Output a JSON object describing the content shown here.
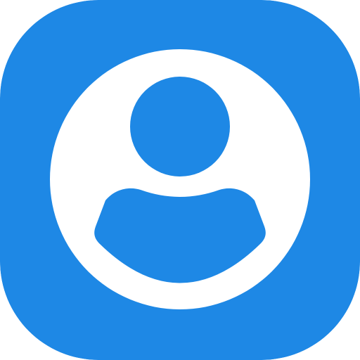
{
  "app_icon": {
    "icon": "user-profile-icon",
    "background_color": "#1E88E5",
    "foreground_color": "#FFFFFF"
  }
}
